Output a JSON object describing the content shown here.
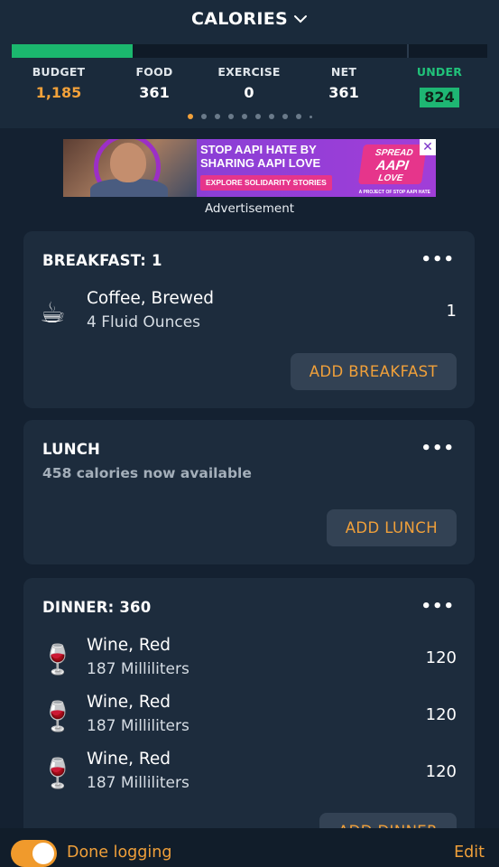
{
  "header": {
    "title": "CALORIES",
    "progress_fraction": 0.255,
    "stats": [
      {
        "label": "BUDGET",
        "value": "1,185"
      },
      {
        "label": "FOOD",
        "value": "361"
      },
      {
        "label": "EXERCISE",
        "value": "0"
      },
      {
        "label": "NET",
        "value": "361"
      },
      {
        "label": "UNDER",
        "value": "824"
      }
    ],
    "page_dots": 10,
    "active_dot": 0
  },
  "ad": {
    "headline": "STOP AAPI HATE BY SHARING AAPI LOVE",
    "cta": "EXPLORE SOLIDARITY STORIES",
    "logo_top": "SPREAD",
    "logo_mid": "AAPI",
    "logo_bottom": "LOVE",
    "project": "A PROJECT OF STOP AAPI HATE",
    "close": "✕",
    "label": "Advertisement"
  },
  "meals": {
    "breakfast": {
      "title": "BREAKFAST: 1",
      "entries": [
        {
          "name": "Coffee, Brewed",
          "detail": "4 Fluid Ounces",
          "calories": "1",
          "icon": "☕"
        }
      ],
      "add_label": "ADD BREAKFAST"
    },
    "lunch": {
      "title": "LUNCH",
      "subtitle": "458 calories now available",
      "add_label": "ADD LUNCH"
    },
    "dinner": {
      "title": "DINNER: 360",
      "entries": [
        {
          "name": "Wine, Red",
          "detail": "187 Milliliters",
          "calories": "120",
          "icon": "🍷"
        },
        {
          "name": "Wine, Red",
          "detail": "187 Milliliters",
          "calories": "120",
          "icon": "🍷"
        },
        {
          "name": "Wine, Red",
          "detail": "187 Milliliters",
          "calories": "120",
          "icon": "🍷"
        }
      ],
      "add_label": "ADD DINNER"
    },
    "more_icon": "•••"
  },
  "footer": {
    "done_label": "Done logging",
    "done_on": true,
    "edit_label": "Edit"
  },
  "colors": {
    "accent": "#f0a03a",
    "progress": "#1bb76e",
    "under_badge": "#1eb673",
    "background": "#142131",
    "card": "#1d2c3d"
  }
}
